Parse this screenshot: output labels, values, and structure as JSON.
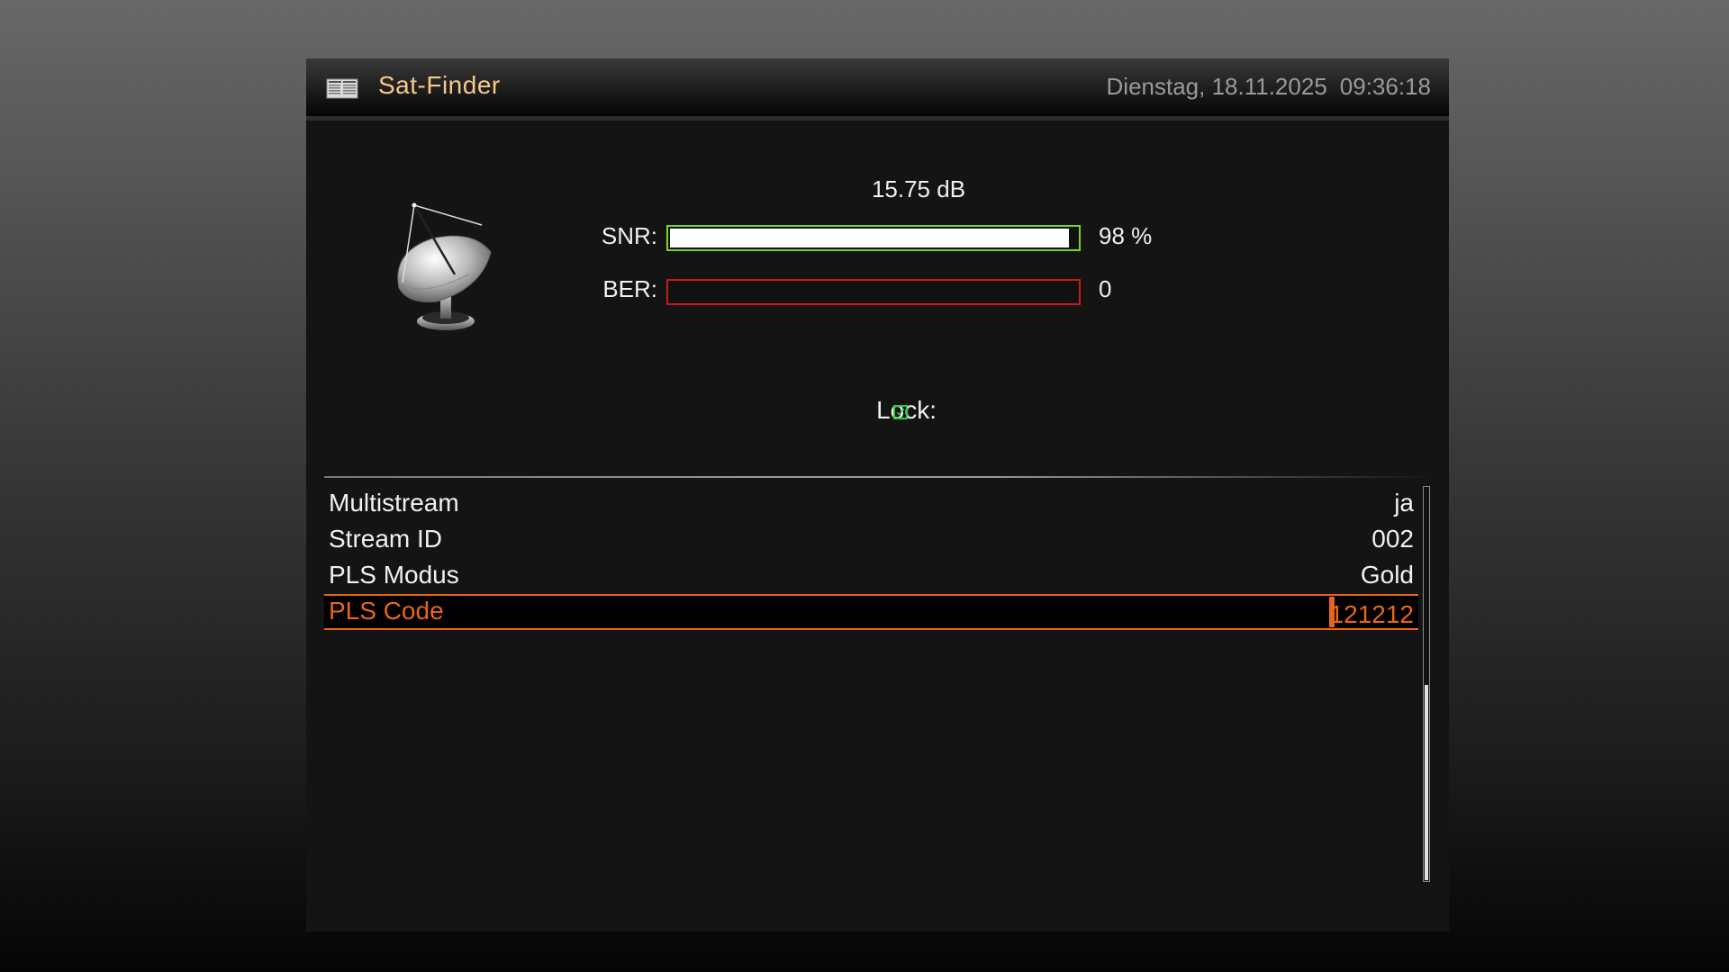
{
  "header": {
    "title": "Sat-Finder",
    "date": "Dienstag, 18.11.2025",
    "time": "09:36:18",
    "icon": "menu-book-icon"
  },
  "signal": {
    "db": "15.75 dB",
    "snr_label": "SNR:",
    "snr_value": "98 %",
    "snr_percent": 98,
    "ber_label": "BER:",
    "ber_value": "0",
    "ber_percent": 0,
    "lock_label": "Lock:",
    "locked": true
  },
  "colors": {
    "accent": "#e8651a",
    "title": "#f5c98a",
    "snr_border": "#7ed321",
    "ber_border": "#cc1a1a",
    "lock": "#2ecc40"
  },
  "settings": [
    {
      "label": "Multistream",
      "value": "ja"
    },
    {
      "label": "Stream ID",
      "value": "002"
    },
    {
      "label": "PLS Modus",
      "value": "Gold"
    },
    {
      "label": "PLS Code",
      "value_cursor": "1",
      "value_rest": "21212",
      "selected": true
    }
  ]
}
